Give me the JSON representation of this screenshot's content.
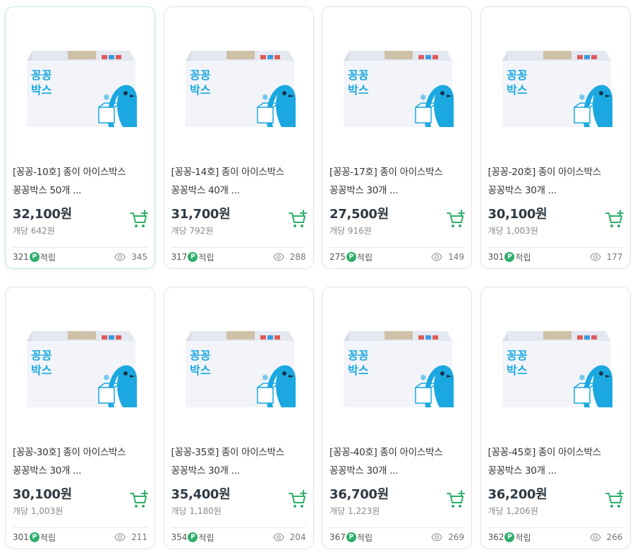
{
  "colors": {
    "accent": "#2fae6a",
    "box_blue": "#1ba8e0",
    "price": "#2f3a44"
  },
  "points_badge": "P",
  "points_suffix": "적립",
  "cart_icon": "add-to-cart-icon",
  "view_icon": "eye-icon",
  "box_logo": [
    "꽁꽁",
    "박스"
  ],
  "products": [
    {
      "title_line1": "[꽁꽁-10호] 종이 아이스박스",
      "title_line2": "꽁꽁박스 50개 ...",
      "price": "32,100원",
      "unit_price": "개당 642원",
      "points": "321",
      "views": "345"
    },
    {
      "title_line1": "[꽁꽁-14호] 종이 아이스박스",
      "title_line2": "꽁꽁박스 40개 ...",
      "price": "31,700원",
      "unit_price": "개당 792원",
      "points": "317",
      "views": "288"
    },
    {
      "title_line1": "[꽁꽁-17호] 종이 아이스박스",
      "title_line2": "꽁꽁박스 30개 ...",
      "price": "27,500원",
      "unit_price": "개당 916원",
      "points": "275",
      "views": "149"
    },
    {
      "title_line1": "[꽁꽁-20호] 종이 아이스박스",
      "title_line2": "꽁꽁박스 30개 ...",
      "price": "30,100원",
      "unit_price": "개당 1,003원",
      "points": "301",
      "views": "177"
    },
    {
      "title_line1": "[꽁꽁-30호] 종이 아이스박스",
      "title_line2": "꽁꽁박스 30개 ...",
      "price": "30,100원",
      "unit_price": "개당 1,003원",
      "points": "301",
      "views": "211"
    },
    {
      "title_line1": "[꽁꽁-35호] 종이 아이스박스",
      "title_line2": "꽁꽁박스 30개 ...",
      "price": "35,400원",
      "unit_price": "개당 1,180원",
      "points": "354",
      "views": "204"
    },
    {
      "title_line1": "[꽁꽁-40호] 종이 아이스박스",
      "title_line2": "꽁꽁박스 30개 ...",
      "price": "36,700원",
      "unit_price": "개당 1,223원",
      "points": "367",
      "views": "269"
    },
    {
      "title_line1": "[꽁꽁-45호] 종이 아이스박스",
      "title_line2": "꽁꽁박스 30개 ...",
      "price": "36,200원",
      "unit_price": "개당 1,206원",
      "points": "362",
      "views": "266"
    }
  ]
}
